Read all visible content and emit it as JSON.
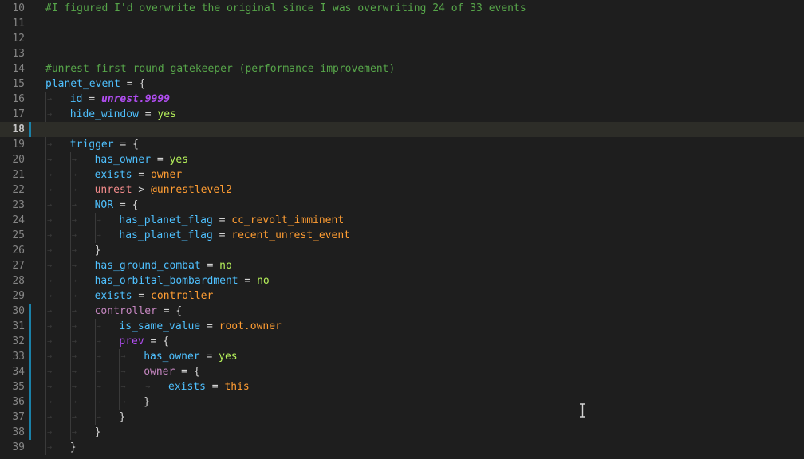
{
  "editor": {
    "current_line": 18,
    "lines": [
      {
        "num": "10",
        "indent": 0,
        "tokens": [
          {
            "t": "#I figured I'd overwrite the original since I was overwriting 24 of 33 events",
            "c": "cmt"
          }
        ]
      },
      {
        "num": "11",
        "indent": 0,
        "tokens": []
      },
      {
        "num": "12",
        "indent": 0,
        "tokens": []
      },
      {
        "num": "13",
        "indent": 0,
        "tokens": []
      },
      {
        "num": "14",
        "indent": 0,
        "tokens": [
          {
            "t": "#unrest first round gatekeeper (performance improvement)",
            "c": "cmt"
          }
        ]
      },
      {
        "num": "15",
        "indent": 0,
        "tokens": [
          {
            "t": "planet_event",
            "c": "key-u"
          },
          {
            "t": " = ",
            "c": "op"
          },
          {
            "t": "{",
            "c": "punc"
          }
        ]
      },
      {
        "num": "16",
        "indent": 1,
        "tokens": [
          {
            "t": "id",
            "c": "key"
          },
          {
            "t": " = ",
            "c": "op"
          },
          {
            "t": "unrest.9999",
            "c": "ital"
          }
        ]
      },
      {
        "num": "17",
        "indent": 1,
        "tokens": [
          {
            "t": "hide_window",
            "c": "key"
          },
          {
            "t": " = ",
            "c": "op"
          },
          {
            "t": "yes",
            "c": "bool"
          }
        ]
      },
      {
        "num": "18",
        "indent": 0,
        "tokens": [],
        "modified": true
      },
      {
        "num": "19",
        "indent": 1,
        "tokens": [
          {
            "t": "trigger",
            "c": "key"
          },
          {
            "t": " = ",
            "c": "op"
          },
          {
            "t": "{",
            "c": "punc"
          }
        ]
      },
      {
        "num": "20",
        "indent": 2,
        "tokens": [
          {
            "t": "has_owner",
            "c": "key"
          },
          {
            "t": " = ",
            "c": "op"
          },
          {
            "t": "yes",
            "c": "bool"
          }
        ]
      },
      {
        "num": "21",
        "indent": 2,
        "tokens": [
          {
            "t": "exists",
            "c": "key"
          },
          {
            "t": " = ",
            "c": "op"
          },
          {
            "t": "owner",
            "c": "str"
          }
        ]
      },
      {
        "num": "22",
        "indent": 2,
        "tokens": [
          {
            "t": "unrest",
            "c": "red"
          },
          {
            "t": " > ",
            "c": "op"
          },
          {
            "t": "@unrestlevel2",
            "c": "str"
          }
        ]
      },
      {
        "num": "23",
        "indent": 2,
        "tokens": [
          {
            "t": "NOR",
            "c": "key"
          },
          {
            "t": " = ",
            "c": "op"
          },
          {
            "t": "{",
            "c": "punc"
          }
        ]
      },
      {
        "num": "24",
        "indent": 3,
        "tokens": [
          {
            "t": "has_planet_flag",
            "c": "key"
          },
          {
            "t": " = ",
            "c": "op"
          },
          {
            "t": "cc_revolt_imminent",
            "c": "str"
          }
        ]
      },
      {
        "num": "25",
        "indent": 3,
        "tokens": [
          {
            "t": "has_planet_flag",
            "c": "key"
          },
          {
            "t": " = ",
            "c": "op"
          },
          {
            "t": "recent_unrest_event",
            "c": "str"
          }
        ]
      },
      {
        "num": "26",
        "indent": 2,
        "tokens": [
          {
            "t": "}",
            "c": "punc"
          }
        ]
      },
      {
        "num": "27",
        "indent": 2,
        "tokens": [
          {
            "t": "has_ground_combat",
            "c": "key"
          },
          {
            "t": " = ",
            "c": "op"
          },
          {
            "t": "no",
            "c": "bool"
          }
        ]
      },
      {
        "num": "28",
        "indent": 2,
        "tokens": [
          {
            "t": "has_orbital_bombardment",
            "c": "key"
          },
          {
            "t": " = ",
            "c": "op"
          },
          {
            "t": "no",
            "c": "bool"
          }
        ]
      },
      {
        "num": "29",
        "indent": 2,
        "tokens": [
          {
            "t": "exists",
            "c": "key"
          },
          {
            "t": " = ",
            "c": "op"
          },
          {
            "t": "controller",
            "c": "str"
          }
        ]
      },
      {
        "num": "30",
        "indent": 2,
        "tokens": [
          {
            "t": "controller",
            "c": "kw"
          },
          {
            "t": " = ",
            "c": "op"
          },
          {
            "t": "{",
            "c": "punc"
          }
        ],
        "modified": true
      },
      {
        "num": "31",
        "indent": 3,
        "tokens": [
          {
            "t": "is_same_value",
            "c": "key"
          },
          {
            "t": " = ",
            "c": "op"
          },
          {
            "t": "root.owner",
            "c": "str"
          }
        ],
        "modified": true
      },
      {
        "num": "32",
        "indent": 3,
        "tokens": [
          {
            "t": "prev",
            "c": "purple"
          },
          {
            "t": " = ",
            "c": "op"
          },
          {
            "t": "{",
            "c": "punc"
          }
        ],
        "modified": true
      },
      {
        "num": "33",
        "indent": 4,
        "tokens": [
          {
            "t": "has_owner",
            "c": "key"
          },
          {
            "t": " = ",
            "c": "op"
          },
          {
            "t": "yes",
            "c": "bool"
          }
        ],
        "modified": true
      },
      {
        "num": "34",
        "indent": 4,
        "tokens": [
          {
            "t": "owner",
            "c": "kw"
          },
          {
            "t": " = ",
            "c": "op"
          },
          {
            "t": "{",
            "c": "punc"
          }
        ],
        "modified": true
      },
      {
        "num": "35",
        "indent": 5,
        "tokens": [
          {
            "t": "exists",
            "c": "key"
          },
          {
            "t": " = ",
            "c": "op"
          },
          {
            "t": "this",
            "c": "str"
          }
        ],
        "modified": true
      },
      {
        "num": "36",
        "indent": 4,
        "tokens": [
          {
            "t": "}",
            "c": "punc"
          }
        ],
        "modified": true
      },
      {
        "num": "37",
        "indent": 3,
        "tokens": [
          {
            "t": "}",
            "c": "punc"
          }
        ],
        "modified": true
      },
      {
        "num": "38",
        "indent": 2,
        "tokens": [
          {
            "t": "}",
            "c": "punc"
          }
        ],
        "modified": true
      },
      {
        "num": "39",
        "indent": 1,
        "tokens": [
          {
            "t": "}",
            "c": "punc"
          }
        ]
      }
    ]
  },
  "colors": {
    "background": "#1e1e1e",
    "current_line": "#2d2d28",
    "modified_marker": "#1b81a8",
    "comment": "#57a64a",
    "key": "#4fc1ff",
    "bool": "#b5f05a",
    "string": "#ff9d33"
  },
  "cursor_icon": "text-cursor-ibeam-icon"
}
